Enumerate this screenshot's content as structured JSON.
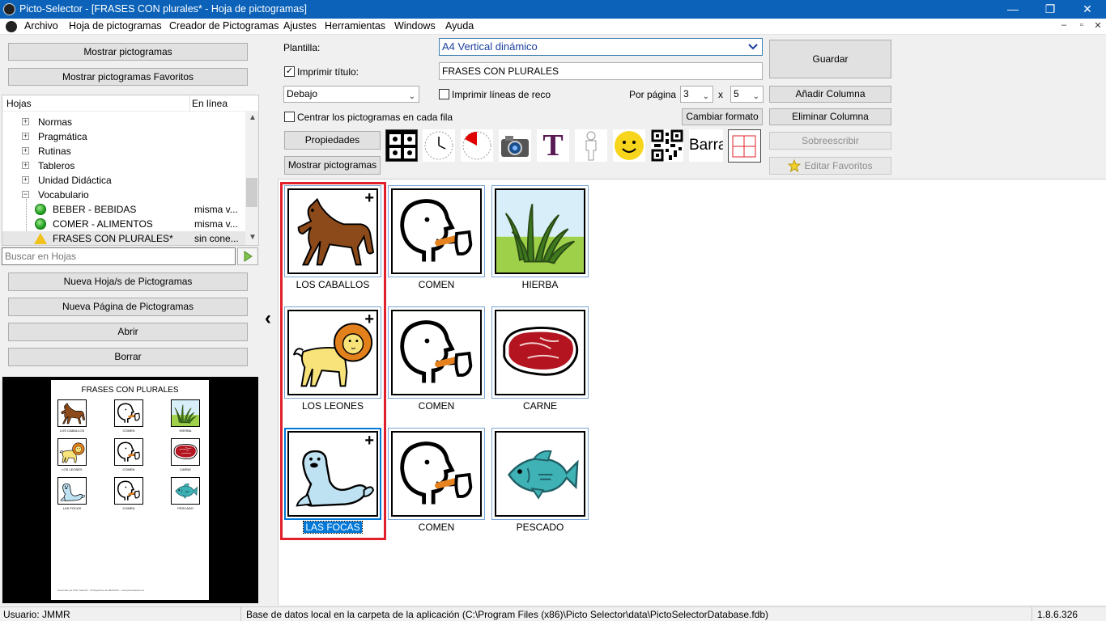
{
  "window": {
    "title": "Picto-Selector - [FRASES CON plurales* - Hoja de pictogramas]",
    "controls": {
      "minimize": "—",
      "restore": "❐",
      "close": "✕"
    }
  },
  "menu": {
    "items": [
      "Archivo",
      "Hoja de pictogramas",
      "Creador de Pictogramas",
      "Ajustes",
      "Herramientas",
      "Windows",
      "Ayuda"
    ],
    "mdi_controls": {
      "minimize": "–",
      "restore": "▫",
      "close": "✕"
    }
  },
  "left": {
    "btn_show_pictos": "Mostrar pictogramas",
    "btn_show_favs": "Mostrar pictogramas Favoritos",
    "tree": {
      "col_sheets": "Hojas",
      "col_online": "En línea",
      "folders": [
        "Normas",
        "Pragmática",
        "Rutinas",
        "Tableros",
        "Unidad Didáctica",
        "Vocabulario"
      ],
      "sheets": [
        {
          "name": "BEBER - BEBIDAS",
          "status": "misma v...",
          "icon": "green-dot-icon"
        },
        {
          "name": "COMER - ALIMENTOS",
          "status": "misma v...",
          "icon": "green-dot-icon"
        },
        {
          "name": "FRASES CON PLURALES*",
          "status": "sin cone...",
          "icon": "warning-icon"
        }
      ]
    },
    "search_placeholder": "Buscar en Hojas",
    "btn_new_sheets": "Nueva Hoja/s de Pictogramas",
    "btn_new_page": "Nueva Página de Pictogramas",
    "btn_open": "Abrir",
    "btn_delete": "Borrar"
  },
  "preview": {
    "title": "FRASES CON PLURALES",
    "labels": [
      [
        "LOS CABALLOS",
        "COMEN",
        "HIERBA"
      ],
      [
        "LOS LEONES",
        "COMEN",
        "CARNE"
      ],
      [
        "LAS FOCAS",
        "COMEN",
        "PESCADO"
      ]
    ],
    "footer": "Generado por Picto Selector - Pictogramas de ARASAAC - www.pictoselector.eu"
  },
  "toolbar": {
    "template_label": "Plantilla:",
    "template_value": "A4 Vertical dinámico",
    "print_title_label": "Imprimir título:",
    "print_title_checked": true,
    "title_value": "FRASES CON PLURALES",
    "position_value": "Debajo",
    "print_lines_label": "Imprimir líneas de reco",
    "print_lines_checked": false,
    "per_page_label": "Por página",
    "rows_value": "3",
    "x_label": "x",
    "cols_value": "5",
    "center_label": "Centrar los pictogramas en cada fila",
    "center_checked": false,
    "btn_change_format": "Cambiar formato",
    "btn_properties": "Propiedades",
    "btn_show_pictos": "Mostrar pictogramas",
    "tool_text_icon": "T",
    "tool_barra": "Barra",
    "btn_save": "Guardar",
    "btn_add_col": "Añadir Columna",
    "btn_del_col": "Eliminar Columna",
    "btn_overwrite": "Sobreescribir",
    "btn_edit_favs": "Editar Favoritos"
  },
  "grid": {
    "cells": [
      {
        "label": "LOS CABALLOS",
        "icon": "horse-icon",
        "plus": "+"
      },
      {
        "label": "COMEN",
        "icon": "eat-icon"
      },
      {
        "label": "HIERBA",
        "icon": "grass-icon"
      },
      {
        "label": "LOS LEONES",
        "icon": "lion-icon",
        "plus": "+"
      },
      {
        "label": "COMEN",
        "icon": "eat-icon"
      },
      {
        "label": "CARNE",
        "icon": "meat-icon"
      },
      {
        "label": "LAS FOCAS",
        "icon": "seal-icon",
        "plus": "+"
      },
      {
        "label": "COMEN",
        "icon": "eat-icon"
      },
      {
        "label": "PESCADO",
        "icon": "fish-icon"
      }
    ],
    "collapse_arrow": "‹",
    "highlight_color": "#e0202b",
    "selection_color": "#0078d7"
  },
  "status": {
    "user": "Usuario: JMMR",
    "db": "Base de datos local en la carpeta de la aplicación (C:\\Program Files (x86)\\Picto Selector\\data\\PictoSelectorDatabase.fdb)",
    "version": "1.8.6.326"
  }
}
